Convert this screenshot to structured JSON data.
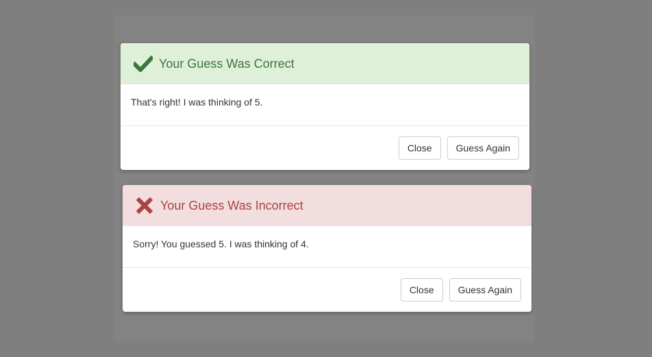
{
  "colors": {
    "overlay": "#7f7f7f",
    "success_header_bg": "#dff0d8",
    "success_text": "#3c763d",
    "danger_header_bg": "#f2dede",
    "danger_text": "#a94442"
  },
  "correct_modal": {
    "icon": "checkmark-icon",
    "title": "Your Guess Was Correct",
    "body": "That's right! I was thinking of 5.",
    "close_label": "Close",
    "guess_again_label": "Guess Again"
  },
  "incorrect_modal": {
    "icon": "x-icon",
    "title": "Your Guess Was Incorrect",
    "body": "Sorry! You guessed 5. I was thinking of 4.",
    "close_label": "Close",
    "guess_again_label": "Guess Again"
  }
}
